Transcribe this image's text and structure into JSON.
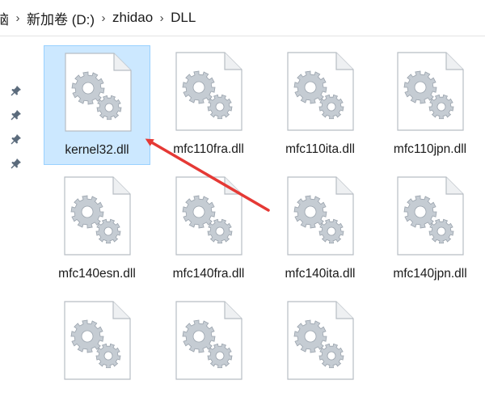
{
  "breadcrumb": {
    "items": [
      "脑",
      "新加卷 (D:)",
      "zhidao",
      "DLL"
    ],
    "separator": "›"
  },
  "files": [
    {
      "name": "kernel32.dll",
      "selected": true
    },
    {
      "name": "mfc110fra.dll",
      "selected": false
    },
    {
      "name": "mfc110ita.dll",
      "selected": false
    },
    {
      "name": "mfc110jpn.dll",
      "selected": false
    },
    {
      "name": "mfc140esn.dll",
      "selected": false
    },
    {
      "name": "mfc140fra.dll",
      "selected": false
    },
    {
      "name": "mfc140ita.dll",
      "selected": false
    },
    {
      "name": "mfc140jpn.dll",
      "selected": false
    },
    {
      "name": "",
      "selected": false
    },
    {
      "name": "",
      "selected": false
    },
    {
      "name": "",
      "selected": false
    }
  ],
  "icons": {
    "file": "dll-file-icon",
    "pin": "pin-icon",
    "annotation": "red-arrow-annotation"
  },
  "colors": {
    "selection_fill": "#cce8ff",
    "selection_border": "#99d1ff",
    "arrow": "#e53935",
    "gear": "#c5ccd3"
  }
}
